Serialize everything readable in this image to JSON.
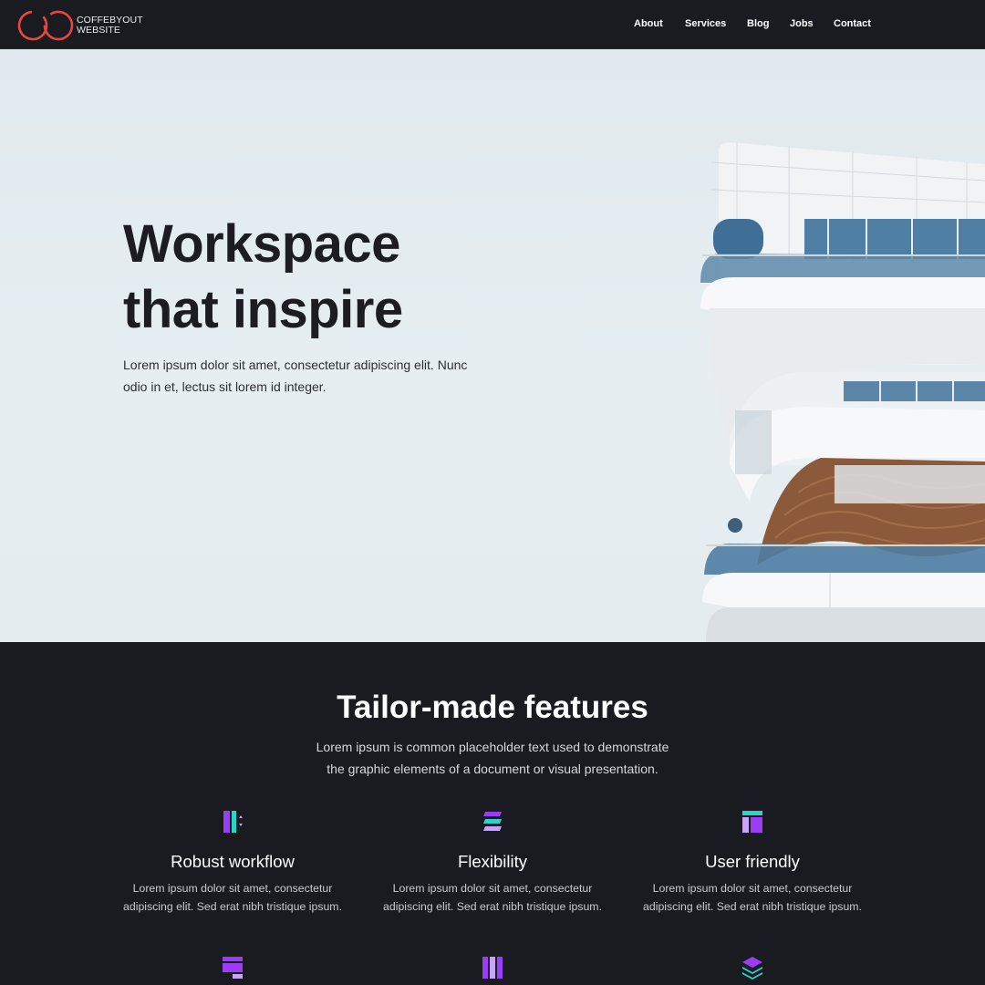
{
  "brand": {
    "line1": "COFFEBYOUT",
    "line2": "WEBSITE",
    "accent": "#e8473f"
  },
  "nav": {
    "items": [
      {
        "label": "About"
      },
      {
        "label": "Services"
      },
      {
        "label": "Blog"
      },
      {
        "label": "Jobs"
      },
      {
        "label": "Contact"
      }
    ]
  },
  "hero": {
    "title_line1": "Workspace",
    "title_line2": "that inspire",
    "subtitle": "Lorem ipsum dolor sit amet, consectetur adipiscing elit. Nunc odio in et, lectus sit lorem id integer."
  },
  "features": {
    "title": "Tailor-made features",
    "subtitle": "Lorem ipsum is common placeholder text used to demonstrate the graphic elements of a document or visual presentation.",
    "items": [
      {
        "icon": "workflow-icon",
        "title": "Robust workflow",
        "desc": "Lorem ipsum dolor sit amet, consectetur adipiscing elit. Sed erat nibh tristique ipsum."
      },
      {
        "icon": "stack-lines-icon",
        "title": "Flexibility",
        "desc": "Lorem ipsum dolor sit amet, consectetur adipiscing elit. Sed erat nibh tristique ipsum."
      },
      {
        "icon": "layout-icon",
        "title": "User friendly",
        "desc": "Lorem ipsum dolor sit amet, consectetur adipiscing elit. Sed erat nibh tristique ipsum."
      }
    ],
    "next_row_icons": [
      "window-icon",
      "columns-icon",
      "layers-icon"
    ]
  },
  "colors": {
    "purple": "#9b3cf6",
    "teal": "#2ad4c9",
    "lavender": "#c9a3f8",
    "dark_bg": "#1a1b21"
  }
}
